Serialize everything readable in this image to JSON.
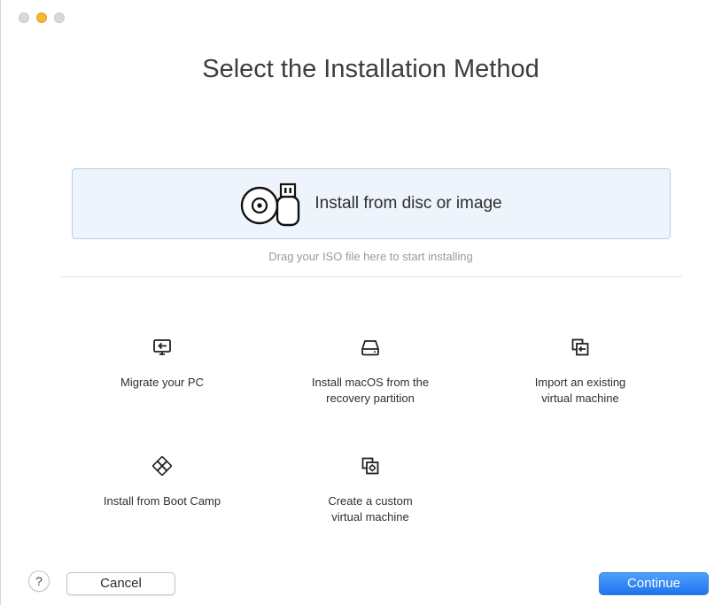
{
  "window": {
    "title": "Select the Installation Method"
  },
  "primary_option": {
    "label": "Install from disc or image",
    "hint": "Drag your ISO file here to start installing",
    "icon": "disc-usb-icon"
  },
  "options": [
    {
      "label": "Migrate your PC",
      "icon": "migrate-pc-icon"
    },
    {
      "label": "Install macOS from the\nrecovery partition",
      "icon": "drive-icon"
    },
    {
      "label": "Import an existing\nvirtual machine",
      "icon": "import-vm-icon"
    },
    {
      "label": "Install from Boot Camp",
      "icon": "boot-camp-icon"
    },
    {
      "label": "Create a custom\nvirtual machine",
      "icon": "custom-vm-icon"
    }
  ],
  "footer": {
    "help_label": "?",
    "cancel_label": "Cancel",
    "continue_label": "Continue"
  },
  "colors": {
    "accent": "#1f74ee",
    "primary_option_bg": "#eef4fb",
    "primary_option_border": "#b9cfe6"
  }
}
